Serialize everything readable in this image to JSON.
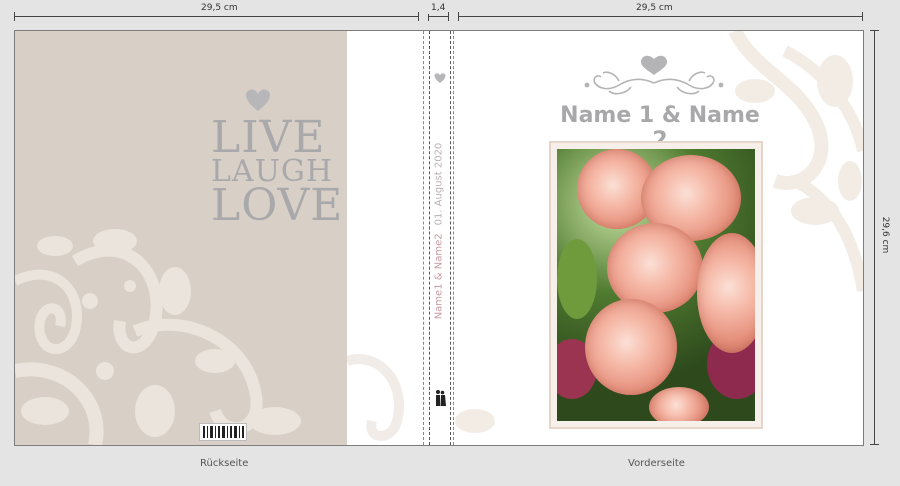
{
  "dimensions": {
    "back_width": "29,5 cm",
    "spine_width": "1,4",
    "front_width": "29,5 cm",
    "height": "29,6 cm"
  },
  "back": {
    "label": "Rückseite",
    "quote_line1": "LIVE",
    "quote_line2": "LAUGH",
    "quote_line3": "LOVE"
  },
  "spine": {
    "names": "Name1 & Name2",
    "date": "01. August 2020"
  },
  "front": {
    "label": "Vorderseite",
    "title": "Name 1 & Name 2"
  },
  "colors": {
    "back_panel": "#d8cfc6",
    "ornament": "#ece6df",
    "silver_text": "#a8a8aa"
  },
  "icons": [
    "heart-icon",
    "flourish-ornament",
    "couple-silhouette-icon",
    "barcode"
  ]
}
